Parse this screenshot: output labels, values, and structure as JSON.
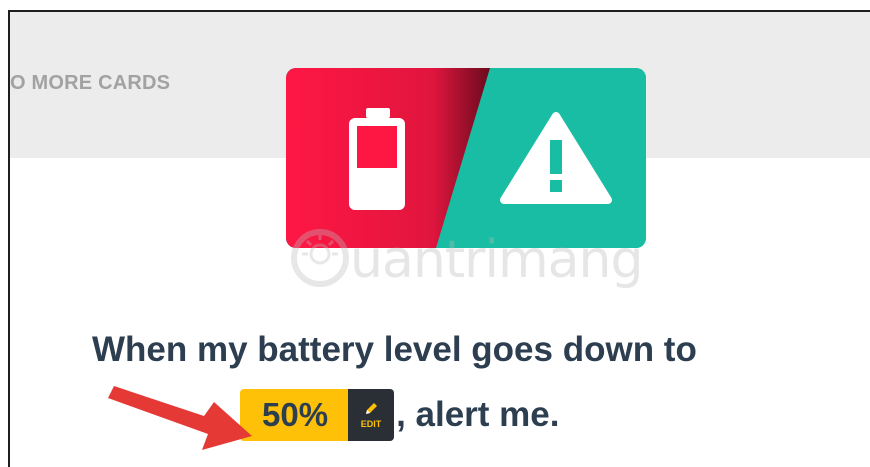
{
  "header": {
    "more_cards_label": "O MORE CARDS"
  },
  "icon_card": {
    "left_color": "#ff1744",
    "right_color": "#19bda3",
    "left_icon": "battery-low-icon",
    "right_icon": "warning-triangle-icon"
  },
  "watermark": {
    "text": "uantrimang",
    "icon": "lightbulb-logo-icon"
  },
  "rule": {
    "line1": "When my battery level goes down to",
    "value": "50%",
    "edit_label": "EDIT",
    "line2_suffix": ", alert me."
  },
  "colors": {
    "text": "#2c3e50",
    "value_bg": "#ffc107",
    "edit_bg": "#2a2f36",
    "arrow": "#e53935"
  }
}
